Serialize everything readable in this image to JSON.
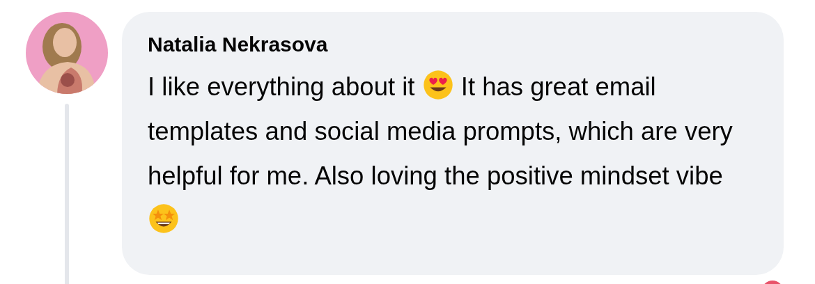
{
  "comment": {
    "author": "Natalia Nekrasova",
    "text_parts": [
      {
        "kind": "text",
        "text": "I like everything about it "
      },
      {
        "kind": "heart_eyes"
      },
      {
        "kind": "text",
        "text": " It has great email templates and social media prompts, which are very helpful for me. Also loving the positive mindset vibe "
      },
      {
        "kind": "star_struck"
      }
    ]
  }
}
